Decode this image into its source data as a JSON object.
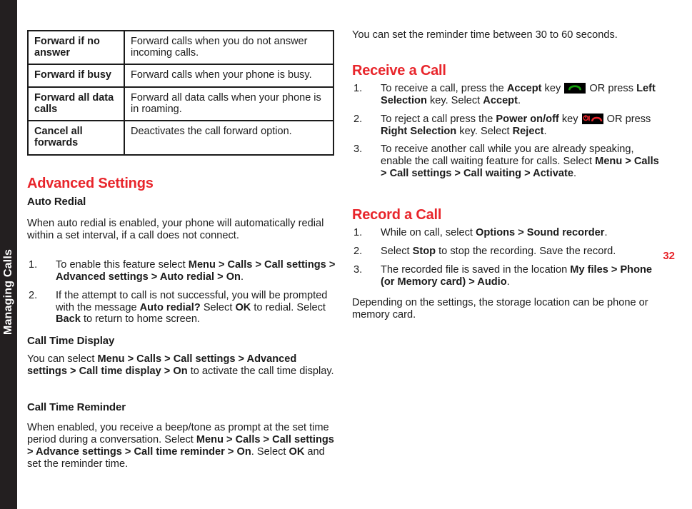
{
  "chapter_tab": {
    "label": "Managing Calls"
  },
  "page_number": "32",
  "colors": {
    "accent_red": "#e8252b",
    "tab_black": "#231f20",
    "text": "#1b1b1b",
    "accept_key_green": "#14a00b",
    "reject_key_red": "#e8252b"
  },
  "left_column": {
    "table": {
      "rows": [
        {
          "term": "Forward if no answer",
          "description": "Forward calls when you do not answer incoming calls."
        },
        {
          "term": "Forward if busy",
          "description": "Forward calls when your phone is busy."
        },
        {
          "term": "Forward all data calls",
          "description": "Forward all data calls when your phone is in roaming."
        },
        {
          "term": "Cancel all forwards",
          "description": "Deactivates the call forward option."
        }
      ]
    },
    "advanced_settings": {
      "heading": "Advanced Settings",
      "auto_redial": {
        "heading": "Auto Redial",
        "intro": "When auto redial is enabled, your phone will automatically redial within a set interval, if a call does not connect.",
        "steps": [
          {
            "num": "1.",
            "parts": [
              {
                "text": "To enable this feature select ",
                "bold": false
              },
              {
                "text": "Menu > Calls > Call settings > Advanced settings > Auto redial > On",
                "bold": true
              },
              {
                "text": ".",
                "bold": false
              }
            ]
          },
          {
            "num": "2.",
            "parts": [
              {
                "text": "If the attempt to call is not successful, you will be prompted with the message ",
                "bold": false
              },
              {
                "text": "Auto redial?",
                "bold": true
              },
              {
                "text": " Select ",
                "bold": false
              },
              {
                "text": "OK",
                "bold": true
              },
              {
                "text": " to redial. Select ",
                "bold": false
              },
              {
                "text": "Back",
                "bold": true
              },
              {
                "text": " to return to home screen.",
                "bold": false
              }
            ]
          }
        ]
      },
      "call_time_display": {
        "heading": "Call Time Display",
        "parts": [
          {
            "text": "You can select ",
            "bold": false
          },
          {
            "text": "Menu > Calls > Call settings > Advanced settings > Call time display > On",
            "bold": true
          },
          {
            "text": " to activate the call time display.",
            "bold": false
          }
        ]
      },
      "call_time_reminder": {
        "heading": "Call Time Reminder",
        "parts": [
          {
            "text": "When enabled, you receive a beep/tone as prompt at the set time period during a conversation. Select ",
            "bold": false
          },
          {
            "text": "Menu > Calls > Call settings > Advance settings > Call time reminder > On",
            "bold": true
          },
          {
            "text": ". Select ",
            "bold": false
          },
          {
            "text": "OK",
            "bold": true
          },
          {
            "text": " and set the reminder time.",
            "bold": false
          }
        ]
      }
    }
  },
  "right_column": {
    "reminder_note": "You can set the reminder time between 30 to 60 seconds.",
    "receive_a_call": {
      "heading": "Receive a Call",
      "steps": [
        {
          "num": "1.",
          "parts": [
            {
              "text": "To receive a call, press the ",
              "bold": false
            },
            {
              "text": "Accept",
              "bold": true
            },
            {
              "text": " key ",
              "bold": false
            },
            {
              "icon": "accept-call-key-icon"
            },
            {
              "text": " OR press ",
              "bold": false
            },
            {
              "text": "Left Selection",
              "bold": true
            },
            {
              "text": " key. Select ",
              "bold": false
            },
            {
              "text": "Accept",
              "bold": true
            },
            {
              "text": ".",
              "bold": false
            }
          ]
        },
        {
          "num": "2.",
          "parts": [
            {
              "text": "To reject a call press the ",
              "bold": false
            },
            {
              "text": "Power on/off",
              "bold": true
            },
            {
              "text": " key ",
              "bold": false
            },
            {
              "icon": "reject-call-key-icon"
            },
            {
              "text": " OR press ",
              "bold": false
            },
            {
              "text": "Right Selection",
              "bold": true
            },
            {
              "text": " key. Select ",
              "bold": false
            },
            {
              "text": "Reject",
              "bold": true
            },
            {
              "text": ".",
              "bold": false
            }
          ]
        },
        {
          "num": "3.",
          "parts": [
            {
              "text": "To receive another call while you are already speaking, enable the call waiting feature for calls. Select ",
              "bold": false
            },
            {
              "text": "Menu > Calls > Call settings > Call waiting > Activate",
              "bold": true
            },
            {
              "text": ".",
              "bold": false
            }
          ]
        }
      ]
    },
    "record_a_call": {
      "heading": "Record a Call",
      "steps": [
        {
          "num": "1.",
          "parts": [
            {
              "text": "While on call, select ",
              "bold": false
            },
            {
              "text": "Options > Sound recorder",
              "bold": true
            },
            {
              "text": ".",
              "bold": false
            }
          ]
        },
        {
          "num": "2.",
          "parts": [
            {
              "text": "Select ",
              "bold": false
            },
            {
              "text": "Stop",
              "bold": true
            },
            {
              "text": " to stop the recording. Save the record.",
              "bold": false
            }
          ]
        },
        {
          "num": "3.",
          "parts": [
            {
              "text": "The recorded file is saved in the location ",
              "bold": false
            },
            {
              "text": "My files > Phone (or Memory card) > Audio",
              "bold": true
            },
            {
              "text": ".",
              "bold": false
            }
          ]
        }
      ],
      "closing_note": "Depending on the settings, the storage location can be phone or memory card."
    }
  }
}
